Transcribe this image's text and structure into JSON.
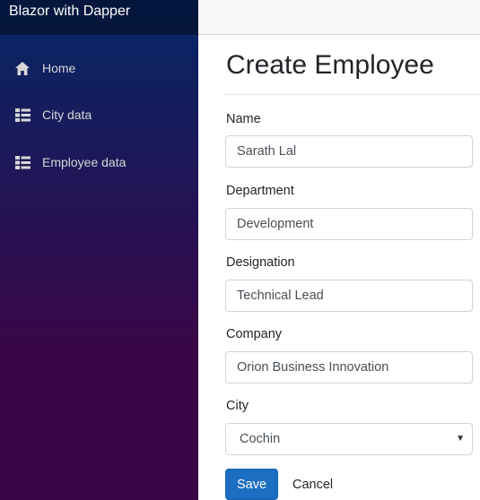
{
  "sidebar": {
    "brand": "Blazor with Dapper",
    "items": [
      {
        "label": "Home",
        "icon": "home-icon"
      },
      {
        "label": "City data",
        "icon": "list-icon"
      },
      {
        "label": "Employee data",
        "icon": "list-icon"
      }
    ]
  },
  "main": {
    "title": "Create Employee",
    "fields": {
      "name": {
        "label": "Name",
        "value": "Sarath Lal"
      },
      "department": {
        "label": "Department",
        "value": "Development"
      },
      "designation": {
        "label": "Designation",
        "value": "Technical Lead"
      },
      "company": {
        "label": "Company",
        "value": "Orion Business Innovation"
      },
      "city": {
        "label": "City",
        "value": "Cochin"
      }
    },
    "actions": {
      "save": "Save",
      "cancel": "Cancel"
    }
  },
  "colors": {
    "primary": "#1b6ec2",
    "sidebar_top": "#052767",
    "sidebar_bottom": "#3a0647"
  }
}
